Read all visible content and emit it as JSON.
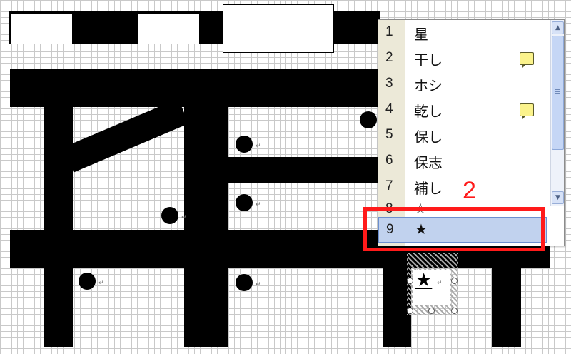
{
  "document": {
    "paragraph_mark": "↵",
    "inserted_symbol": "★"
  },
  "ime": {
    "candidates": [
      {
        "num": "1",
        "text": "星",
        "has_note": false,
        "selected": false
      },
      {
        "num": "2",
        "text": "干し",
        "has_note": true,
        "selected": false
      },
      {
        "num": "3",
        "text": "ホシ",
        "has_note": false,
        "selected": false
      },
      {
        "num": "4",
        "text": "乾し",
        "has_note": true,
        "selected": false
      },
      {
        "num": "5",
        "text": "保し",
        "has_note": false,
        "selected": false
      },
      {
        "num": "6",
        "text": "保志",
        "has_note": false,
        "selected": false
      },
      {
        "num": "7",
        "text": "補し",
        "has_note": false,
        "selected": false
      },
      {
        "num": "8",
        "text": "☆",
        "has_note": false,
        "selected": false
      },
      {
        "num": "9",
        "text": "★",
        "has_note": false,
        "selected": true
      }
    ],
    "scroll_up_icon": "chevron-up-icon",
    "scroll_down_icon": "chevron-down-icon"
  },
  "annotation": {
    "callout_number": "2",
    "highlight_color": "#ff1a1a"
  },
  "colors": {
    "selection_fill": "#c1d2ee",
    "selection_border": "#6c8fcf",
    "grid_line": "#c9c9c9",
    "note_icon": "#fbf38c"
  }
}
